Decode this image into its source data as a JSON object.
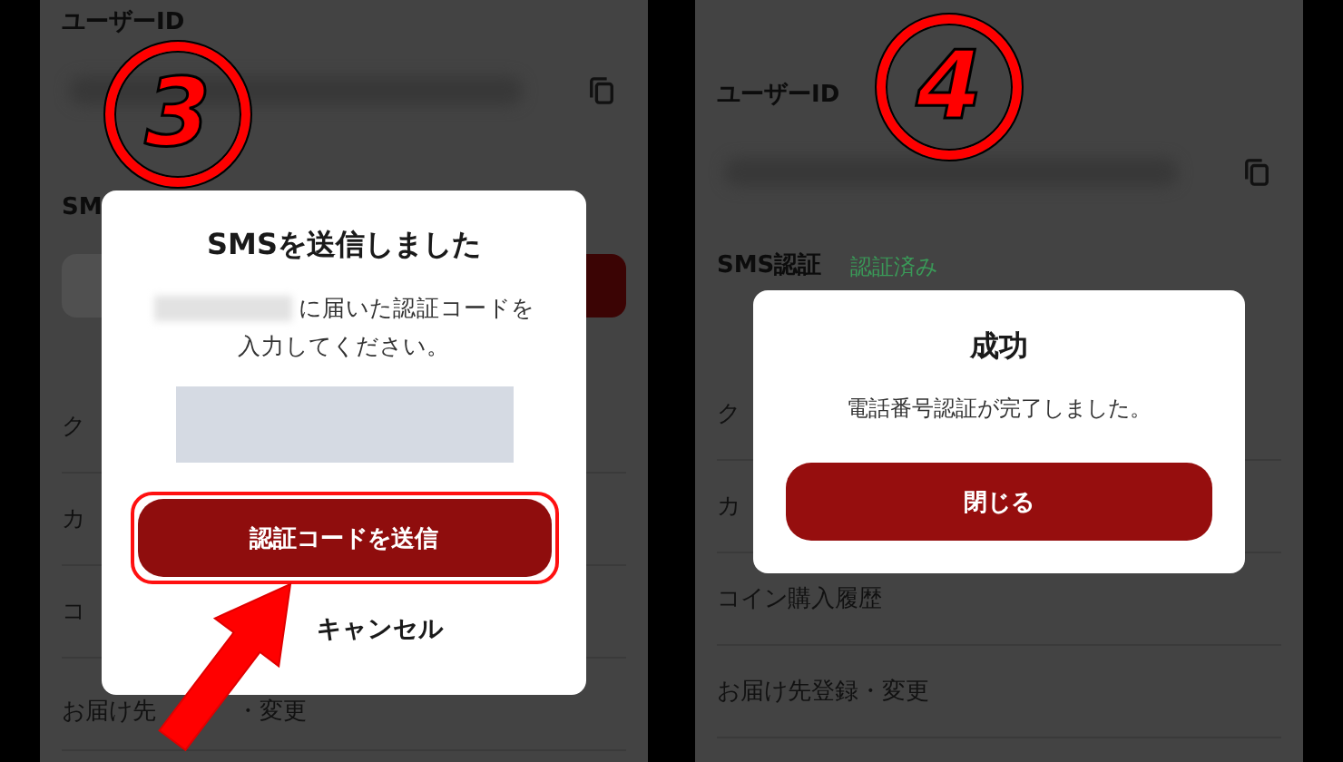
{
  "panels": [
    {
      "kind": "entry",
      "step": "3",
      "user_id_label": "ユーザーID",
      "sms_label": "SM",
      "pointer": true,
      "rows": [
        {
          "text": "ク"
        },
        {
          "text": "カ"
        },
        {
          "text": "コ"
        },
        {
          "text": "お届け先",
          "text_2": "・変更"
        }
      ],
      "dialog": {
        "kind": "code_entry",
        "title": "SMSを送信しました",
        "message": "に届いた認証コードを",
        "message_2": "入力してください。",
        "primary_button": {
          "label": "認証コードを送信",
          "highlighted": true
        },
        "secondary_button": "キャンセル"
      }
    },
    {
      "kind": "done",
      "step": "4",
      "user_id_label": "ユーザーID",
      "sms_label": "SMS認証",
      "sms_status": "認証済み",
      "rows": [
        {
          "text": "ク"
        },
        {
          "text": "カ"
        },
        {
          "text": "コイン購入履歴"
        },
        {
          "text": "お届け先登録・変更"
        }
      ],
      "dialog": {
        "kind": "result",
        "title": "成功",
        "message": "電話番号認証が完了しました。",
        "primary_button": {
          "label": "閉じる",
          "highlighted": false
        }
      }
    }
  ]
}
